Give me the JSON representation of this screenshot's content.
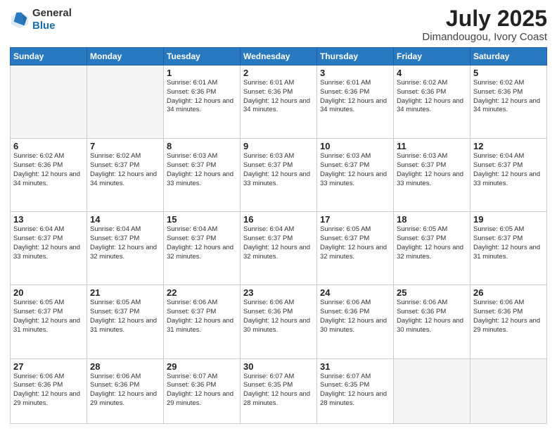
{
  "header": {
    "logo_general": "General",
    "logo_blue": "Blue",
    "month": "July 2025",
    "location": "Dimandougou, Ivory Coast"
  },
  "days_of_week": [
    "Sunday",
    "Monday",
    "Tuesday",
    "Wednesday",
    "Thursday",
    "Friday",
    "Saturday"
  ],
  "weeks": [
    [
      {
        "day": "",
        "empty": true
      },
      {
        "day": "",
        "empty": true
      },
      {
        "day": "1",
        "sunrise": "6:01 AM",
        "sunset": "6:36 PM",
        "daylight": "12 hours and 34 minutes."
      },
      {
        "day": "2",
        "sunrise": "6:01 AM",
        "sunset": "6:36 PM",
        "daylight": "12 hours and 34 minutes."
      },
      {
        "day": "3",
        "sunrise": "6:01 AM",
        "sunset": "6:36 PM",
        "daylight": "12 hours and 34 minutes."
      },
      {
        "day": "4",
        "sunrise": "6:02 AM",
        "sunset": "6:36 PM",
        "daylight": "12 hours and 34 minutes."
      },
      {
        "day": "5",
        "sunrise": "6:02 AM",
        "sunset": "6:36 PM",
        "daylight": "12 hours and 34 minutes."
      }
    ],
    [
      {
        "day": "6",
        "sunrise": "6:02 AM",
        "sunset": "6:36 PM",
        "daylight": "12 hours and 34 minutes."
      },
      {
        "day": "7",
        "sunrise": "6:02 AM",
        "sunset": "6:37 PM",
        "daylight": "12 hours and 34 minutes."
      },
      {
        "day": "8",
        "sunrise": "6:03 AM",
        "sunset": "6:37 PM",
        "daylight": "12 hours and 33 minutes."
      },
      {
        "day": "9",
        "sunrise": "6:03 AM",
        "sunset": "6:37 PM",
        "daylight": "12 hours and 33 minutes."
      },
      {
        "day": "10",
        "sunrise": "6:03 AM",
        "sunset": "6:37 PM",
        "daylight": "12 hours and 33 minutes."
      },
      {
        "day": "11",
        "sunrise": "6:03 AM",
        "sunset": "6:37 PM",
        "daylight": "12 hours and 33 minutes."
      },
      {
        "day": "12",
        "sunrise": "6:04 AM",
        "sunset": "6:37 PM",
        "daylight": "12 hours and 33 minutes."
      }
    ],
    [
      {
        "day": "13",
        "sunrise": "6:04 AM",
        "sunset": "6:37 PM",
        "daylight": "12 hours and 33 minutes."
      },
      {
        "day": "14",
        "sunrise": "6:04 AM",
        "sunset": "6:37 PM",
        "daylight": "12 hours and 32 minutes."
      },
      {
        "day": "15",
        "sunrise": "6:04 AM",
        "sunset": "6:37 PM",
        "daylight": "12 hours and 32 minutes."
      },
      {
        "day": "16",
        "sunrise": "6:04 AM",
        "sunset": "6:37 PM",
        "daylight": "12 hours and 32 minutes."
      },
      {
        "day": "17",
        "sunrise": "6:05 AM",
        "sunset": "6:37 PM",
        "daylight": "12 hours and 32 minutes."
      },
      {
        "day": "18",
        "sunrise": "6:05 AM",
        "sunset": "6:37 PM",
        "daylight": "12 hours and 32 minutes."
      },
      {
        "day": "19",
        "sunrise": "6:05 AM",
        "sunset": "6:37 PM",
        "daylight": "12 hours and 31 minutes."
      }
    ],
    [
      {
        "day": "20",
        "sunrise": "6:05 AM",
        "sunset": "6:37 PM",
        "daylight": "12 hours and 31 minutes."
      },
      {
        "day": "21",
        "sunrise": "6:05 AM",
        "sunset": "6:37 PM",
        "daylight": "12 hours and 31 minutes."
      },
      {
        "day": "22",
        "sunrise": "6:06 AM",
        "sunset": "6:37 PM",
        "daylight": "12 hours and 31 minutes."
      },
      {
        "day": "23",
        "sunrise": "6:06 AM",
        "sunset": "6:36 PM",
        "daylight": "12 hours and 30 minutes."
      },
      {
        "day": "24",
        "sunrise": "6:06 AM",
        "sunset": "6:36 PM",
        "daylight": "12 hours and 30 minutes."
      },
      {
        "day": "25",
        "sunrise": "6:06 AM",
        "sunset": "6:36 PM",
        "daylight": "12 hours and 30 minutes."
      },
      {
        "day": "26",
        "sunrise": "6:06 AM",
        "sunset": "6:36 PM",
        "daylight": "12 hours and 29 minutes."
      }
    ],
    [
      {
        "day": "27",
        "sunrise": "6:06 AM",
        "sunset": "6:36 PM",
        "daylight": "12 hours and 29 minutes."
      },
      {
        "day": "28",
        "sunrise": "6:06 AM",
        "sunset": "6:36 PM",
        "daylight": "12 hours and 29 minutes."
      },
      {
        "day": "29",
        "sunrise": "6:07 AM",
        "sunset": "6:36 PM",
        "daylight": "12 hours and 29 minutes."
      },
      {
        "day": "30",
        "sunrise": "6:07 AM",
        "sunset": "6:35 PM",
        "daylight": "12 hours and 28 minutes."
      },
      {
        "day": "31",
        "sunrise": "6:07 AM",
        "sunset": "6:35 PM",
        "daylight": "12 hours and 28 minutes."
      },
      {
        "day": "",
        "empty": true
      },
      {
        "day": "",
        "empty": true
      }
    ]
  ]
}
